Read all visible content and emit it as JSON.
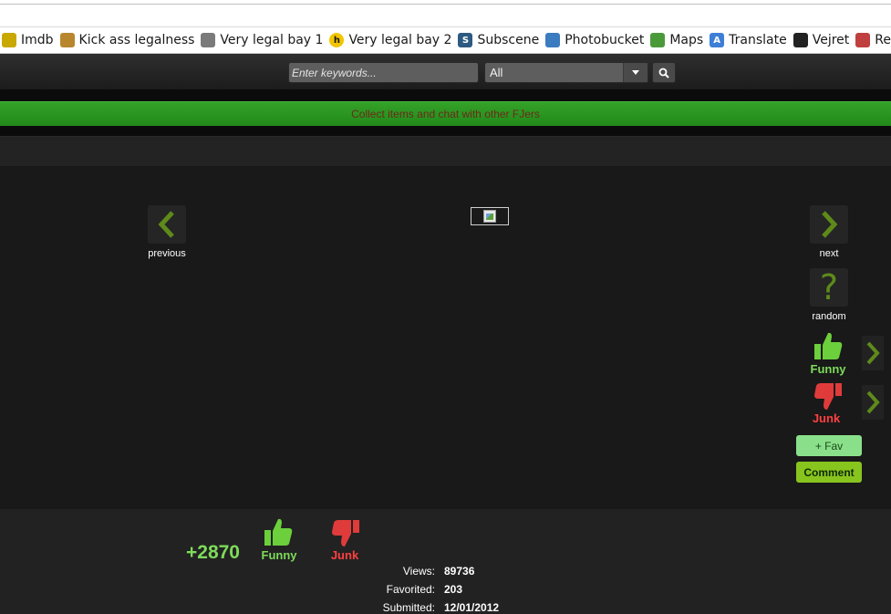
{
  "bookmarks": [
    {
      "label": "Imdb",
      "icon": "imdb-icon",
      "color": "#c9a800"
    },
    {
      "label": "Kick ass legalness",
      "icon": "shield-icon",
      "color": "#b8862d"
    },
    {
      "label": "Very legal bay 1",
      "icon": "ship-icon",
      "color": "#7a7a7a"
    },
    {
      "label": "Very legal bay 2",
      "icon": "h-logo-icon",
      "color": "#f2c500"
    },
    {
      "label": "Subscene",
      "icon": "s-logo-icon",
      "color": "#2d5a80"
    },
    {
      "label": "Photobucket",
      "icon": "camera-icon",
      "color": "#3b7bbf"
    },
    {
      "label": "Maps",
      "icon": "map-pin-icon",
      "color": "#4a9a3a"
    },
    {
      "label": "Translate",
      "icon": "translate-icon",
      "color": "#3d7fd6"
    },
    {
      "label": "Vejret",
      "icon": "tv2-icon",
      "color": "#222222"
    },
    {
      "label": "Redd",
      "icon": "reddit-icon",
      "color": "#c04040"
    }
  ],
  "search": {
    "placeholder": "Enter keywords...",
    "category": "All"
  },
  "banner": {
    "text": "Collect items and chat with other FJers"
  },
  "nav": {
    "previous": "previous",
    "next": "next",
    "random": "random"
  },
  "side_actions": {
    "funny": "Funny",
    "junk": "Junk",
    "fav": "+ Fav",
    "comment": "Comment"
  },
  "footer": {
    "score": "+2870",
    "funny": "Funny",
    "junk": "Junk",
    "stats": [
      {
        "label": "Views:",
        "value": "89736"
      },
      {
        "label": "Favorited:",
        "value": "203"
      },
      {
        "label": "Submitted:",
        "value": "12/01/2012"
      }
    ]
  },
  "colors": {
    "funny_green": "#7ddb5a",
    "junk_red": "#e84040",
    "banner_green": "#2b9620",
    "arrow_green": "#6a9a1e"
  }
}
